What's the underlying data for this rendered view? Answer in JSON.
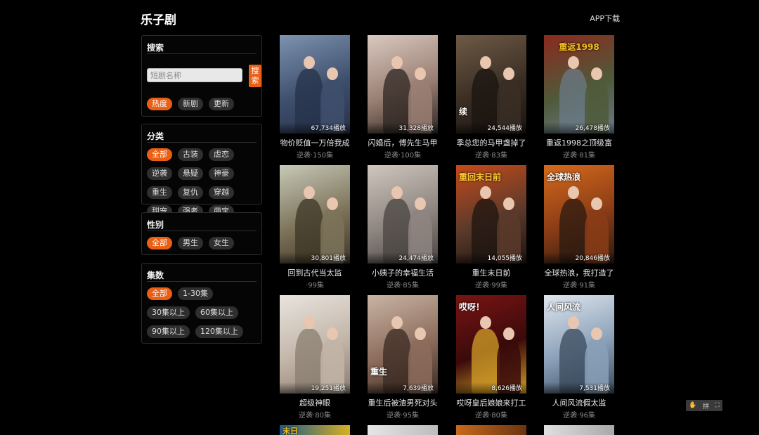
{
  "header": {
    "brand": "乐子剧",
    "app_download": "APP下载"
  },
  "filters": {
    "search": {
      "title": "搜索",
      "placeholder": "短剧名称",
      "button": "搜索",
      "sorts": [
        {
          "label": "热度",
          "active": true
        },
        {
          "label": "新剧",
          "active": false
        },
        {
          "label": "更新",
          "active": false
        }
      ]
    },
    "category": {
      "title": "分类",
      "options": [
        {
          "label": "全部",
          "active": true
        },
        {
          "label": "古装",
          "active": false
        },
        {
          "label": "虐恋",
          "active": false
        },
        {
          "label": "逆袭",
          "active": false
        },
        {
          "label": "悬疑",
          "active": false
        },
        {
          "label": "神豪",
          "active": false
        },
        {
          "label": "重生",
          "active": false
        },
        {
          "label": "复仇",
          "active": false
        },
        {
          "label": "穿越",
          "active": false
        },
        {
          "label": "甜宠",
          "active": false
        },
        {
          "label": "强者",
          "active": false
        },
        {
          "label": "萌宝",
          "active": false
        }
      ]
    },
    "gender": {
      "title": "性别",
      "options": [
        {
          "label": "全部",
          "active": true
        },
        {
          "label": "男生",
          "active": false
        },
        {
          "label": "女生",
          "active": false
        }
      ]
    },
    "episodes": {
      "title": "集数",
      "options": [
        {
          "label": "全部",
          "active": true
        },
        {
          "label": "1-30集",
          "active": false
        },
        {
          "label": "30集以上",
          "active": false
        },
        {
          "label": "60集以上",
          "active": false
        },
        {
          "label": "90集以上",
          "active": false
        },
        {
          "label": "120集以上",
          "active": false
        }
      ]
    }
  },
  "dramas": [
    {
      "title": "物价贬值一万倍我成",
      "meta": "逆袭·150集",
      "plays": "67,734播放",
      "caption": "",
      "colors": [
        "#7d93b0",
        "#3e4f6c",
        "#26314a"
      ]
    },
    {
      "title": "闪婚后，傅先生马甲",
      "meta": "逆袭·100集",
      "plays": "31,328播放",
      "caption": "",
      "colors": [
        "#d9c9c0",
        "#9a7f73",
        "#2e2521"
      ]
    },
    {
      "title": "季总您的马甲盏掉了",
      "meta": "逆袭·83集",
      "plays": "24,544播放",
      "caption": "续",
      "colors": [
        "#6e5a45",
        "#3a2e24",
        "#1a1410"
      ]
    },
    {
      "title": "重返1998之顶级富",
      "meta": "逆袭·81集",
      "plays": "26,478播放",
      "caption": "重返1998",
      "colors": [
        "#8a2a1e",
        "#4f5a3a",
        "#6b7a88"
      ]
    },
    {
      "title": "回到古代当太监",
      "meta": "·99集",
      "plays": "30,801播放",
      "caption": "",
      "colors": [
        "#c7c9b8",
        "#7d735a",
        "#3e3526"
      ]
    },
    {
      "title": "小姨子的幸福生活",
      "meta": "逆袭·85集",
      "plays": "24,474播放",
      "caption": "",
      "colors": [
        "#cfc6be",
        "#8e8580",
        "#4a4440"
      ]
    },
    {
      "title": "重生末日前",
      "meta": "逆袭·99集",
      "plays": "14,055播放",
      "caption": "重回末日前",
      "colors": [
        "#c64a1c",
        "#5a3a2a",
        "#1e1410"
      ]
    },
    {
      "title": "全球热浪，我打造了",
      "meta": "逆袭·91集",
      "plays": "20,846播放",
      "caption": "全球热浪",
      "colors": [
        "#d56a1c",
        "#8a3c16",
        "#2a1a10"
      ]
    },
    {
      "title": "超级神眼",
      "meta": "逆袭·80集",
      "plays": "19,251播放",
      "caption": "",
      "colors": [
        "#e9e4de",
        "#c2b5a8",
        "#8a7d70"
      ]
    },
    {
      "title": "重生后被渣男死对头",
      "meta": "逆袭·95集",
      "plays": "7,639播放",
      "caption": "重生",
      "colors": [
        "#c9b4a4",
        "#8c6c5c",
        "#3a2a22"
      ]
    },
    {
      "title": "哎呀皇后娘娘来打工",
      "meta": "逆袭·80集",
      "plays": "8,626播放",
      "caption": "哎呀！",
      "colors": [
        "#7a1414",
        "#3a0a0a",
        "#d4a028"
      ]
    },
    {
      "title": "人间风流假太监",
      "meta": "逆袭·96集",
      "plays": "7,531播放",
      "caption": "人间风流",
      "colors": [
        "#dfe6ee",
        "#8aa0b8",
        "#3a4a5c"
      ]
    }
  ],
  "next_row_partial": [
    {
      "caption": "末日",
      "colors": [
        "#1f5a8a",
        "#d8b020"
      ]
    },
    {
      "caption": "",
      "colors": [
        "#e6e6e6",
        "#bcbcbc"
      ]
    },
    {
      "caption": "",
      "colors": [
        "#c76a1c",
        "#6a3410"
      ]
    },
    {
      "caption": "",
      "colors": [
        "#e0e0e0",
        "#a8a8a8"
      ]
    }
  ],
  "tools": {
    "icons": [
      "hand-icon",
      "grid-icon",
      "expand-icon"
    ],
    "labels": [
      "✋",
      "拼",
      "⛶"
    ]
  }
}
